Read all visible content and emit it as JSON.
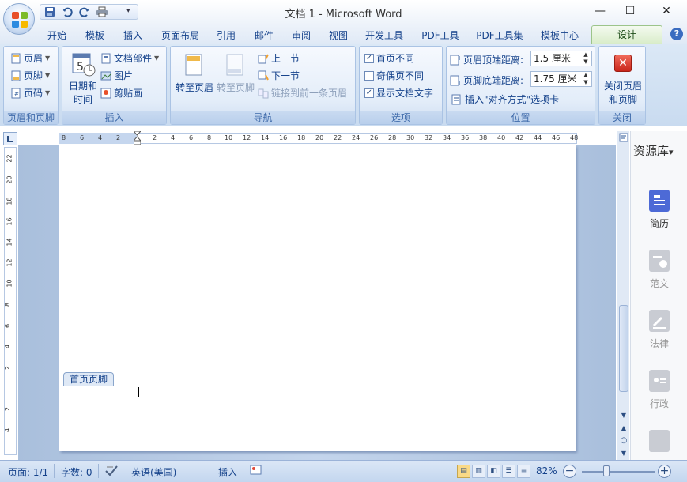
{
  "window": {
    "title": "文档 1 - Microsoft Word",
    "minimize": "—",
    "maximize": "☐",
    "close": "✕"
  },
  "qat": {
    "save_icon": "save-icon",
    "undo_icon": "undo-icon",
    "redo_icon": "redo-icon",
    "print_icon": "print-icon",
    "more": "▾"
  },
  "tabs": [
    {
      "label": "开始"
    },
    {
      "label": "模板"
    },
    {
      "label": "插入"
    },
    {
      "label": "页面布局"
    },
    {
      "label": "引用"
    },
    {
      "label": "邮件"
    },
    {
      "label": "审阅"
    },
    {
      "label": "视图"
    },
    {
      "label": "开发工具"
    },
    {
      "label": "PDF工具"
    },
    {
      "label": "PDF工具集"
    },
    {
      "label": "模板中心"
    },
    {
      "label": "设计"
    }
  ],
  "help": "?",
  "ribbon": {
    "group_header_footer": {
      "label": "页眉和页脚",
      "header": "页眉",
      "footer": "页脚",
      "page_number": "页码"
    },
    "group_insert": {
      "label": "插入",
      "date_time_line1": "日期和",
      "date_time_line2": "时间",
      "doc_parts": "文档部件",
      "picture": "图片",
      "clip_art": "剪贴画",
      "calendar_number": "5"
    },
    "group_nav": {
      "label": "导航",
      "goto_header": "转至页眉",
      "goto_footer": "转至页脚",
      "prev_section": "上一节",
      "next_section": "下一节",
      "link_prev": "链接到前一条页眉"
    },
    "group_options": {
      "label": "选项",
      "first_page_diff": "首页不同",
      "odd_even_diff": "奇偶页不同",
      "show_doc_text": "显示文档文字",
      "first_page_checked": "✓",
      "show_doc_checked": "✓"
    },
    "group_position": {
      "label": "位置",
      "header_top_label": "页眉顶端距离:",
      "header_top_value": "1.5 厘米",
      "footer_bottom_label": "页脚底端距离:",
      "footer_bottom_value": "1.75 厘米",
      "insert_align_tab": "插入\"对齐方式\"选项卡"
    },
    "group_close": {
      "label": "关闭",
      "close_line1": "关闭页眉",
      "close_line2": "和页脚"
    }
  },
  "ruler": {
    "h_ticks": [
      "8",
      "6",
      "4",
      "2",
      "2",
      "4",
      "6",
      "8",
      "10",
      "12",
      "14",
      "16",
      "18",
      "20",
      "22",
      "24",
      "26",
      "28",
      "30",
      "32",
      "34",
      "36",
      "38",
      "40",
      "42",
      "44",
      "46",
      "48"
    ],
    "v_ticks": [
      "22",
      "20",
      "18",
      "16",
      "14",
      "12",
      "10",
      "8",
      "6",
      "4",
      "2",
      "2",
      "4"
    ]
  },
  "document": {
    "footer_tag": "首页页脚"
  },
  "sidepanel": {
    "title": "资源库",
    "title_caret": "▾",
    "items": [
      {
        "label": "简历"
      },
      {
        "label": "范文"
      },
      {
        "label": "法律"
      },
      {
        "label": "行政"
      }
    ]
  },
  "status": {
    "page": "页面: 1/1",
    "words": "字数: 0",
    "language": "英语(美国)",
    "mode": "插入",
    "zoom": "82%",
    "zoom_minus": "−",
    "zoom_plus": "+"
  },
  "colors": {
    "accent": "#15428b",
    "ribbon_bg": "#dbe8f6",
    "active_tab": "#d8ecc8",
    "workspace": "#a9bfdc"
  }
}
